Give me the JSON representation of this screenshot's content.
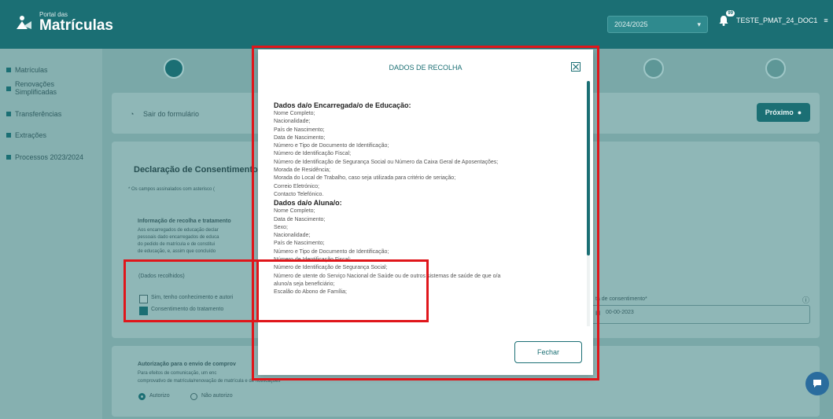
{
  "header": {
    "logo_sub": "Portal das",
    "logo_title": "Matrículas",
    "year": "2024/2025",
    "notif_badge": "99",
    "user": "TESTE_PMAT_24_DOC1"
  },
  "sidebar": {
    "items": [
      {
        "label": "Matrículas"
      },
      {
        "label": "Renovações Simplificadas"
      },
      {
        "label": "Transferências"
      },
      {
        "label": "Extrações"
      },
      {
        "label": "Processos 2023/2024"
      }
    ]
  },
  "main": {
    "exit_label": "Sair do formulário",
    "next_label": "Próximo",
    "section_title": "Declaração de Consentimento",
    "required_note": "* Os campos assinalados com asterisco (",
    "info_title": "Informação de recolha e tratamento",
    "info_lines": [
      "Aos encarregados de educação declar",
      "pessoais dado encarregados de educa",
      "do pedido de matrícula e de constitui",
      "de educação, e, assim que concluído"
    ],
    "collected_label": "(Dados recolhidos)",
    "check1_label": "Sim, tenho conhecimento e autori",
    "check2_label": "Consentimento do tratamento",
    "date_label": "ta de consentimento*",
    "date_value": "00-00-2023",
    "auth_title": "Autorização para o envio de comprov",
    "auth_line1": "Para efeitos de comunicação, um enc",
    "auth_line2": "comprovativo de matrícula/renovação de matrícula e de notificações *",
    "radio_yes": "Autorizo",
    "radio_no": "Não autorizo"
  },
  "modal": {
    "title": "DADOS DE RECOLHA",
    "close_label": "Fechar",
    "section1_heading": "Dados da/o Encarregada/o de Educação:",
    "section1_items": [
      "Nome Completo;",
      "Nacionalidade;",
      "País de Nascimento;",
      "Data de Nascimento;",
      "Número e Tipo de Documento de Identificação;",
      "Número de Identificação Fiscal;",
      "Número de Identificação de Segurança Social ou Número da Caixa Geral de Aposentações;",
      "Morada de Residência;",
      "Morada do Local de Trabalho, caso seja utilizada para critério de seriação;",
      "Correio Eletrónico;",
      "Contacto Telefónico."
    ],
    "section2_heading": "Dados da/o Aluna/o:",
    "section2_items": [
      "Nome Completo;",
      "Data de Nascimento;",
      "Sexo;",
      "Nacionalidade;",
      "País de Nascimento;",
      "Número e Tipo de Documento de Identificação;",
      "Número de Identificação Fiscal;",
      "Número de Identificação de Segurança Social;",
      "Número de utente do Serviço Nacional de Saúde ou de outros sistemas de saúde de que o/a",
      "aluno/a seja beneficiário;",
      "Escalão do Abono de Família;"
    ]
  },
  "colors": {
    "brand": "#1b6f74",
    "annotation": "#e0161b"
  }
}
